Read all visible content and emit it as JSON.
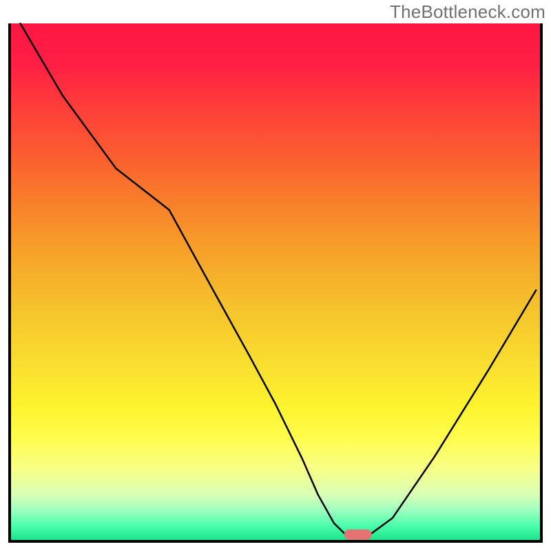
{
  "watermark": "TheBottleneck.com",
  "chart_data": {
    "type": "line",
    "title": "",
    "xlabel": "",
    "ylabel": "",
    "xlim": [
      0,
      100
    ],
    "ylim": [
      0,
      100
    ],
    "grid": false,
    "gradient_stops": [
      {
        "offset": 0.0,
        "color": "#ff1744"
      },
      {
        "offset": 0.08,
        "color": "#ff1f44"
      },
      {
        "offset": 0.16,
        "color": "#ff3d3a"
      },
      {
        "offset": 0.26,
        "color": "#fb5f2f"
      },
      {
        "offset": 0.36,
        "color": "#f8852a"
      },
      {
        "offset": 0.46,
        "color": "#f6a82a"
      },
      {
        "offset": 0.56,
        "color": "#f6c52d"
      },
      {
        "offset": 0.66,
        "color": "#f9df2f"
      },
      {
        "offset": 0.74,
        "color": "#fef32f"
      },
      {
        "offset": 0.8,
        "color": "#fffd4c"
      },
      {
        "offset": 0.86,
        "color": "#f8ff86"
      },
      {
        "offset": 0.91,
        "color": "#d9ffb6"
      },
      {
        "offset": 0.94,
        "color": "#9effc0"
      },
      {
        "offset": 0.97,
        "color": "#4bfeaa"
      },
      {
        "offset": 1.0,
        "color": "#18e089"
      }
    ],
    "series": [
      {
        "name": "bottleneck-curve",
        "type": "line",
        "color": "#000000",
        "stroke_width": 2.5,
        "x": [
          2.0,
          10.0,
          20.0,
          30.0,
          38.0,
          45.0,
          50.0,
          55.0,
          58.0,
          61.0,
          63.0,
          68.0,
          72.0,
          80.0,
          90.0,
          99.0
        ],
        "values": [
          100.0,
          86.0,
          72.0,
          64.0,
          49.0,
          36.0,
          26.5,
          16.0,
          9.0,
          3.5,
          1.5,
          1.5,
          4.5,
          16.5,
          33.0,
          48.5
        ]
      }
    ],
    "marker": {
      "name": "optimal-zone",
      "shape": "pill",
      "fill": "#e57373",
      "x_center": 65.5,
      "x_halfwidth": 2.6,
      "y": 1.3,
      "pill_height": 2.0
    },
    "border": {
      "sides": [
        "left",
        "right",
        "bottom"
      ],
      "color": "#000000",
      "width": 4
    }
  }
}
